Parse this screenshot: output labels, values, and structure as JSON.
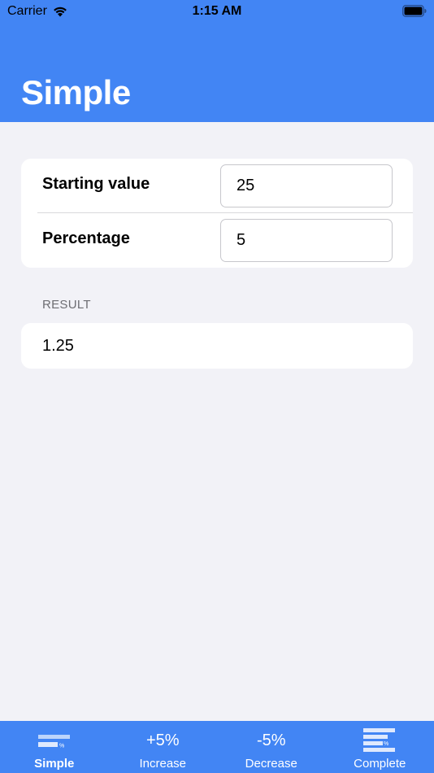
{
  "status_bar": {
    "carrier": "Carrier",
    "time": "1:15 AM"
  },
  "header": {
    "title": "Simple",
    "background_color": "#4285f4"
  },
  "form": {
    "starting_value": {
      "label": "Starting value",
      "value": "25"
    },
    "percentage": {
      "label": "Percentage",
      "value": "5"
    }
  },
  "result": {
    "section_header": "RESULT",
    "value": "1.25"
  },
  "tab_bar": {
    "background_color": "#4285f4",
    "tabs": [
      {
        "label": "Simple",
        "icon": "simple-percent-icon",
        "active": true
      },
      {
        "label": "Increase",
        "icon_text": "+5%",
        "active": false
      },
      {
        "label": "Decrease",
        "icon_text": "-5%",
        "active": false
      },
      {
        "label": "Complete",
        "icon": "complete-percent-icon",
        "active": false
      }
    ]
  }
}
